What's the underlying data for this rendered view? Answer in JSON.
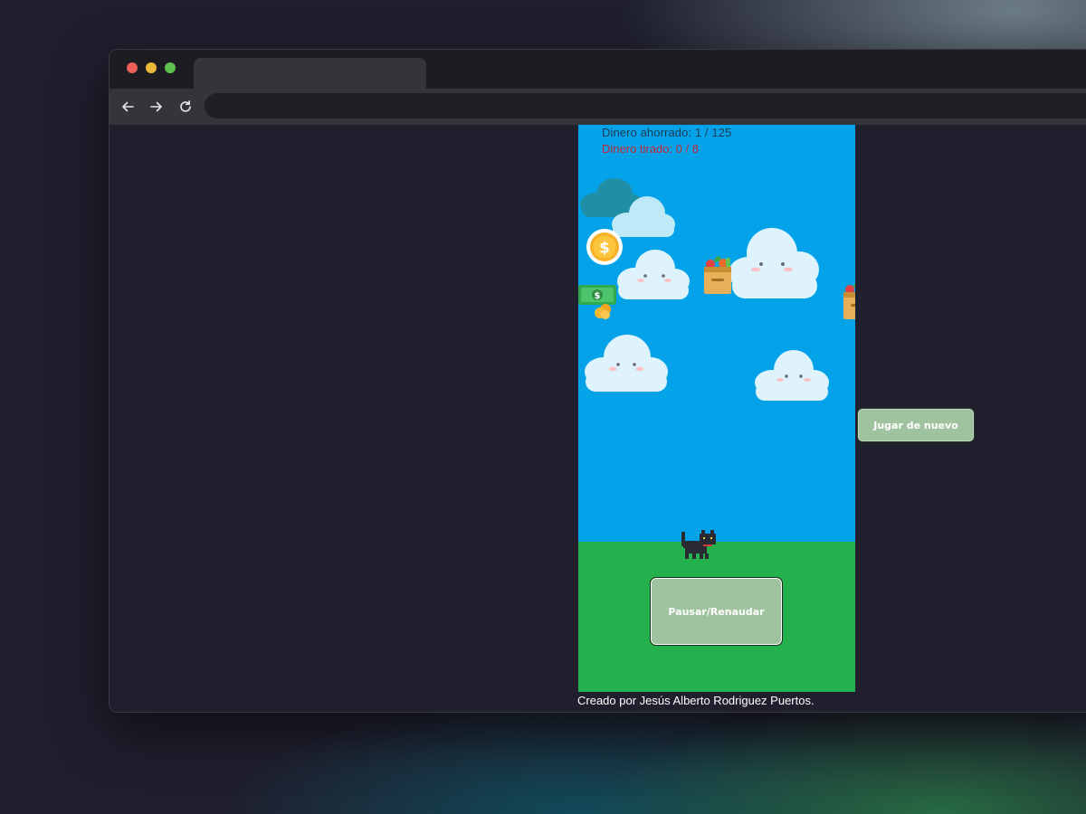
{
  "browser": {
    "tab_title": "",
    "url": "",
    "back_icon": "arrow-left-icon",
    "forward_icon": "arrow-right-icon",
    "reload_icon": "reload-icon"
  },
  "game": {
    "saved_label": "Dinero ahorrado: 1 / 125",
    "lost_label": "Dinero tirado: 0 / 8",
    "pause_button": "Pausar/Renaudar",
    "replay_button": "Jugar de nuevo",
    "credits": "Creado por Jesús Alberto Rodriguez Puertos.",
    "sprites": [
      "cloud-icon",
      "coin-icon",
      "cash-icon",
      "grocery-bag-icon",
      "cat-player-icon"
    ],
    "colors": {
      "sky": "#04a3e9",
      "ground": "#24b14d",
      "button": "#a0c39f",
      "lost_text": "#c0283a"
    }
  }
}
